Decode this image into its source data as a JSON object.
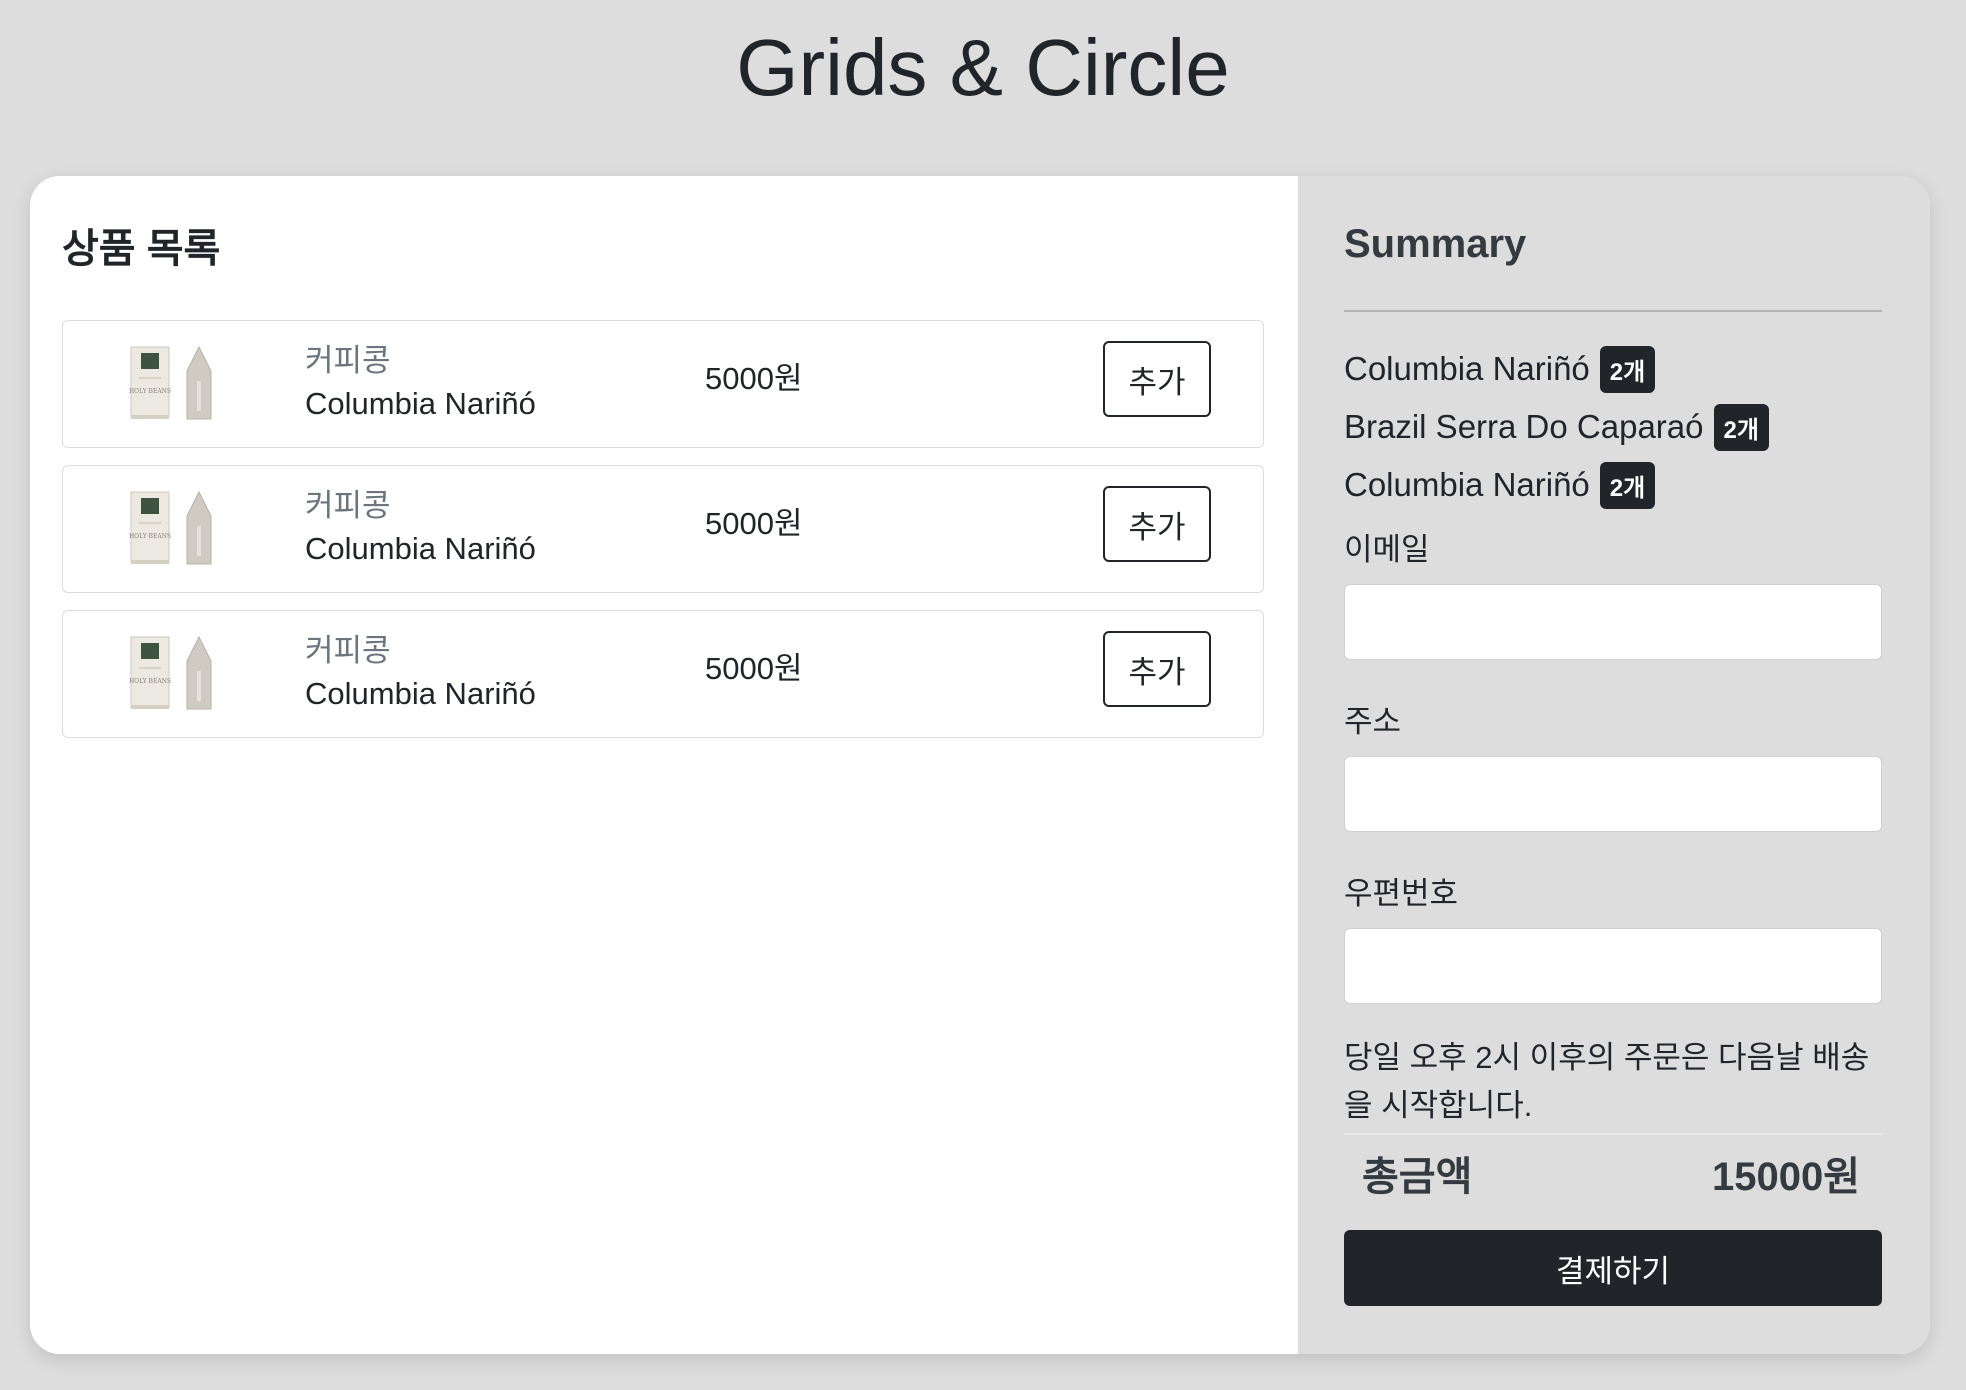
{
  "page_title": "Grids & Circle",
  "products": {
    "heading": "상품 목록",
    "items": [
      {
        "category": "커피콩",
        "name": "Columbia Nariñó",
        "price": "5000원",
        "add_label": "추가"
      },
      {
        "category": "커피콩",
        "name": "Columbia Nariñó",
        "price": "5000원",
        "add_label": "추가"
      },
      {
        "category": "커피콩",
        "name": "Columbia Nariñó",
        "price": "5000원",
        "add_label": "추가"
      }
    ],
    "thumbnail_icon": "coffee-bag-icon",
    "thumbnail_text": "HOLY BEANS"
  },
  "summary": {
    "heading": "Summary",
    "items": [
      {
        "name": "Columbia Nariñó",
        "qty": "2개"
      },
      {
        "name": "Brazil Serra Do Caparaó",
        "qty": "2개"
      },
      {
        "name": "Columbia Nariñó",
        "qty": "2개"
      }
    ],
    "email_label": "이메일",
    "email_value": "",
    "address_label": "주소",
    "address_value": "",
    "zip_label": "우편번호",
    "zip_value": "",
    "notice": "당일 오후 2시 이후의 주문은 다음날 배송을 시작합니다.",
    "total_label": "총금액",
    "total_value": "15000원",
    "checkout_label": "결제하기"
  },
  "colors": {
    "background": "#dddddd",
    "dark": "#212529",
    "muted": "#6c757d"
  }
}
